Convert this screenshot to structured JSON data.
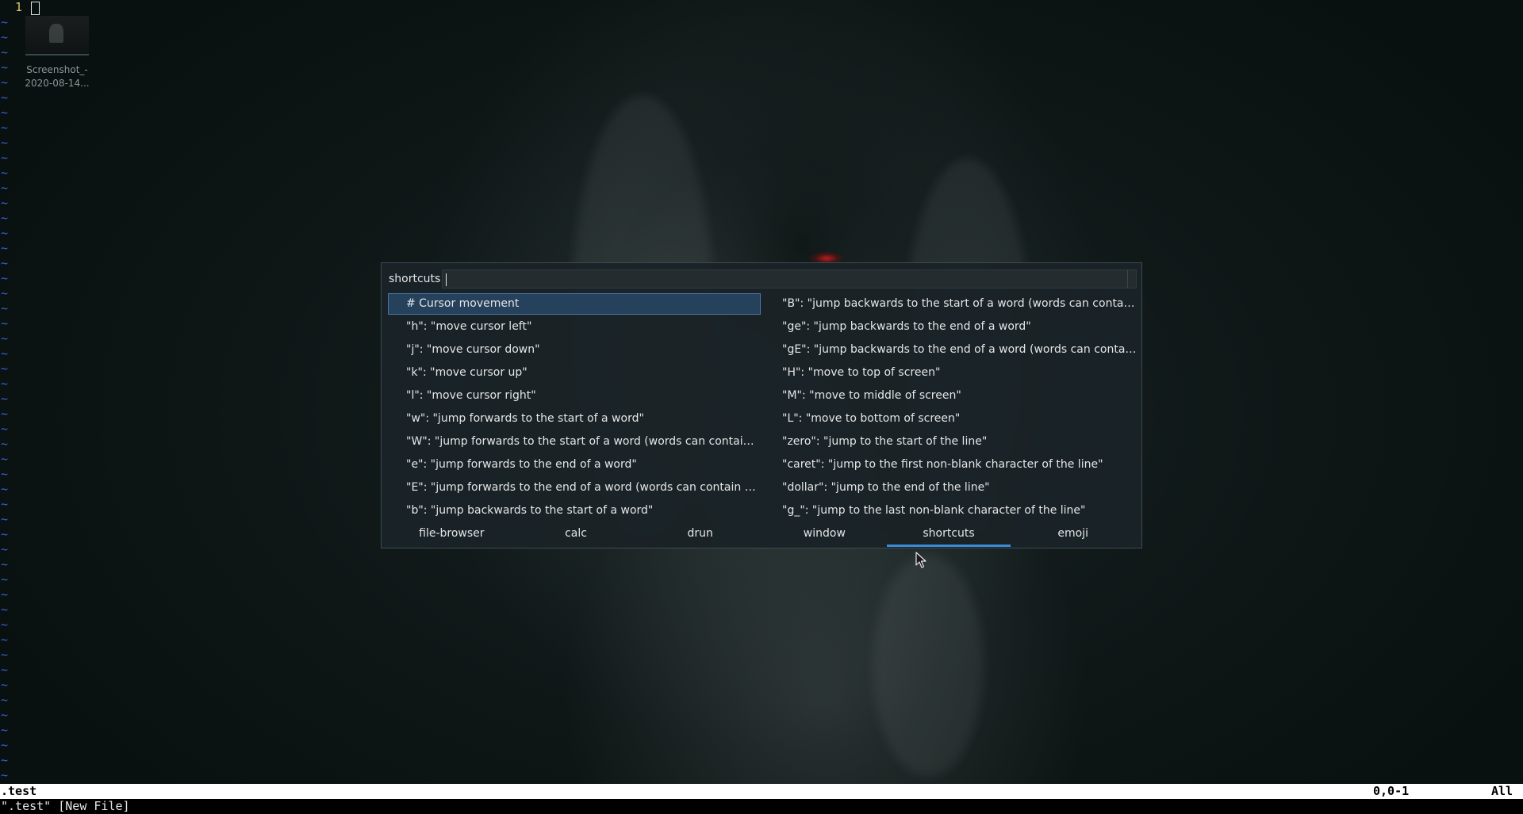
{
  "editor": {
    "line_number": "1",
    "tilde": "~",
    "status_filename": ".test",
    "status_position": "0,0-1",
    "status_scroll": "All",
    "command_message": "\".test\" [New File]"
  },
  "desktop_icon": {
    "label_line1": "Screenshot_-",
    "label_line2": "2020-08-14..."
  },
  "rofi": {
    "prompt": "shortcuts",
    "input_value": "",
    "left_items": [
      "# Cursor movement",
      "\"h\": \"move cursor left\"",
      "\"j\": \"move cursor down\"",
      "\"k\": \"move cursor up\"",
      "\"l\": \"move cursor right\"",
      "\"w\": \"jump forwards to the start of a word\"",
      "\"W\": \"jump forwards to the start of a word (words can contain pu...",
      "\"e\": \"jump forwards to the end of a word\"",
      "\"E\": \"jump forwards to the end of a word (words can contain punc...",
      "\"b\": \"jump backwards to the start of a word\""
    ],
    "right_items": [
      "\"B\": \"jump backwards to the start of a word (words can contain p...",
      "\"ge\": \"jump backwards to the end of a word\"",
      "\"gE\": \"jump backwards to the end of a word (words can contain p...",
      "\"H\": \"move to top of screen\"",
      "\"M\": \"move to middle of screen\"",
      "\"L\": \"move to bottom of screen\"",
      "\"zero\": \"jump to the start of the line\"",
      "\"caret\": \"jump to the first non-blank character of the line\"",
      "\"dollar\": \"jump to the end of the line\"",
      "\"g_\": \"jump to the last non-blank character of the line\""
    ],
    "modes": [
      "file-browser",
      "calc",
      "drun",
      "window",
      "shortcuts",
      "emoji"
    ],
    "active_mode": "shortcuts"
  },
  "colors": {
    "selection_bg": "#26415c",
    "accent": "#3a8ad8",
    "tilde": "#3b5fd8",
    "line_number": "#d8c86a"
  },
  "icons": {
    "pointer": "mouse-pointer-icon"
  }
}
